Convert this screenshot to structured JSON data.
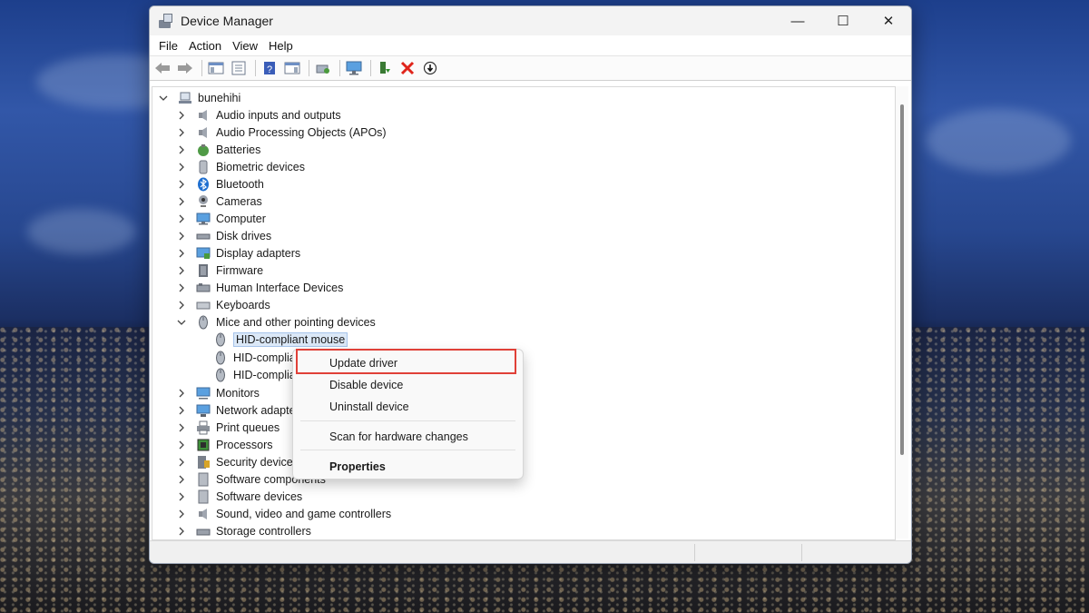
{
  "window": {
    "title": "Device Manager",
    "controls": {
      "minimize": "—",
      "maximize": "☐",
      "close": "✕"
    }
  },
  "menu": {
    "items": [
      "File",
      "Action",
      "View",
      "Help"
    ]
  },
  "toolbar": {
    "icons": [
      "back-arrow-icon",
      "forward-arrow-icon",
      "show-hide-console-tree-icon",
      "properties-sheet-icon",
      "help-icon",
      "show-hide-action-pane-icon",
      "scan-hardware-icon",
      "monitor-icon",
      "update-driver-icon",
      "uninstall-x-icon",
      "disable-device-icon"
    ]
  },
  "tree": {
    "root": "bunehihi",
    "categories": [
      "Audio inputs and outputs",
      "Audio Processing Objects (APOs)",
      "Batteries",
      "Biometric devices",
      "Bluetooth",
      "Cameras",
      "Computer",
      "Disk drives",
      "Display adapters",
      "Firmware",
      "Human Interface Devices",
      "Keyboards",
      "Mice and other pointing devices"
    ],
    "mice_children": [
      "HID-compliant mouse",
      "HID-complia",
      "HID-complia"
    ],
    "categories_after": [
      "Monitors",
      "Network adapte",
      "Print queues",
      "Processors",
      "Security devices",
      "Software components",
      "Software devices",
      "Sound, video and game controllers",
      "Storage controllers"
    ]
  },
  "context_menu": {
    "update_driver": "Update driver",
    "disable_device": "Disable device",
    "uninstall_device": "Uninstall device",
    "scan": "Scan for hardware changes",
    "properties": "Properties"
  },
  "colors": {
    "highlight_border": "#e04038",
    "selection": "#dbe8f7",
    "accent_blue": "#1f6fd0"
  }
}
